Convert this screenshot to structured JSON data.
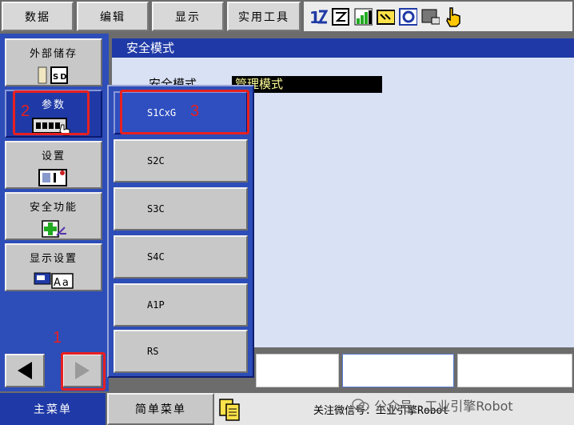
{
  "topbar": {
    "buttons": [
      "数据",
      "编辑",
      "显示",
      "实用工具"
    ]
  },
  "left_menu": {
    "items": [
      {
        "label": "外部储存",
        "icon": "sd-card-icon"
      },
      {
        "label": "参数",
        "icon": "parameter-icon"
      },
      {
        "label": "设置",
        "icon": "setup-icon"
      },
      {
        "label": "安全功能",
        "icon": "safety-icon"
      },
      {
        "label": "显示设置",
        "icon": "display-setting-icon"
      }
    ]
  },
  "window": {
    "title": "安全模式",
    "field_label": "安全模式",
    "field_value": "管理模式"
  },
  "submenu": {
    "items": [
      "S1CxG",
      "S2C",
      "S3C",
      "S4C",
      "A1P",
      "RS"
    ]
  },
  "bottom": {
    "main_menu": "主菜单",
    "simple_menu": "简单菜单",
    "wechat": "关注微信号：工业引擎Robot"
  },
  "watermark": "公众号 · 工业引擎Robot",
  "annotations": {
    "step1": "1",
    "step2": "2",
    "step3": "3"
  },
  "colors": {
    "accent": "#2d4db8",
    "annotation": "#e82020",
    "field_text": "#ffff99"
  }
}
